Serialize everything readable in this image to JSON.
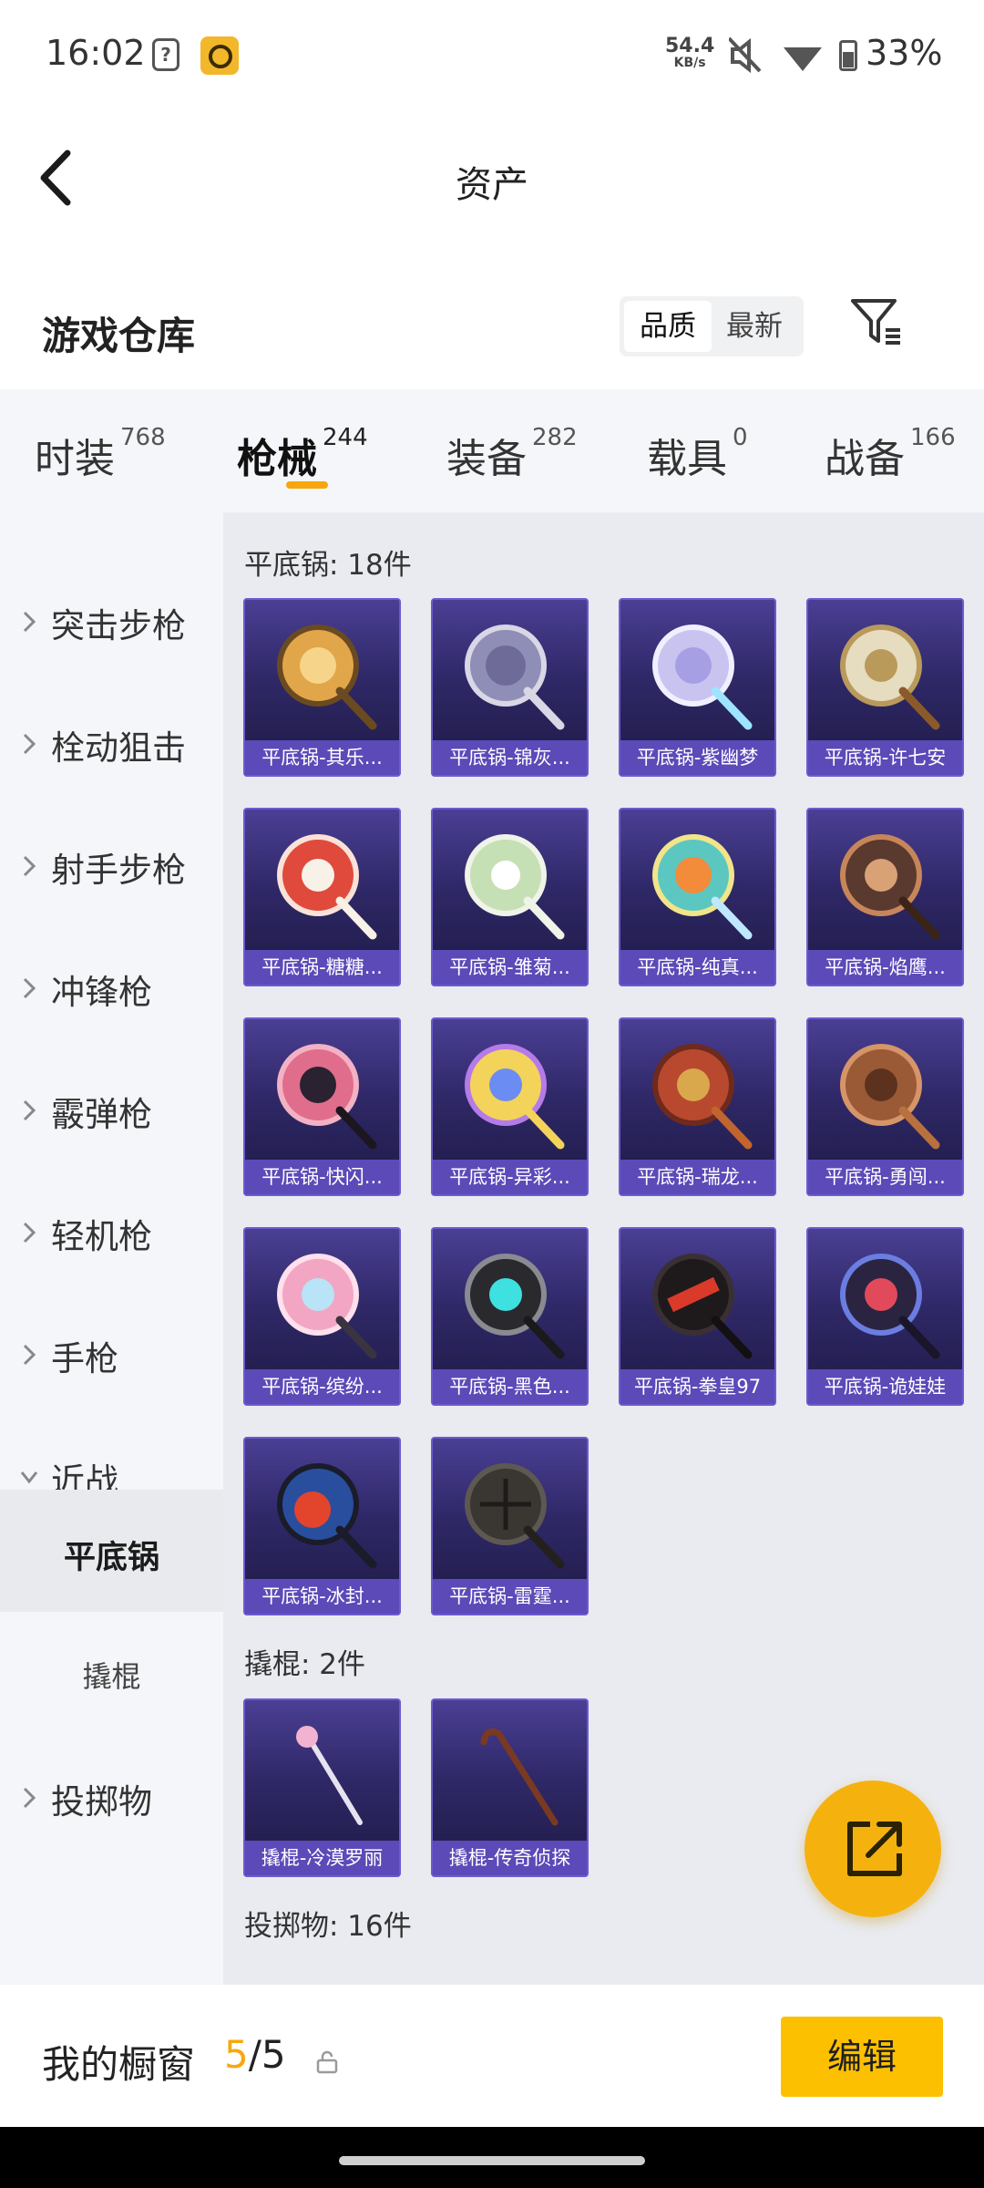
{
  "status_bar": {
    "time": "16:02",
    "notification_icon_glyph": "?",
    "net_speed_value": "54.4",
    "net_speed_unit": "KB/s",
    "battery": "33%",
    "icons": [
      "clock-time",
      "unknown-notification-icon",
      "app-icon",
      "mute-icon",
      "wifi-icon",
      "battery-icon"
    ]
  },
  "header": {
    "title": "资产",
    "back_icon": "chevron-left-icon"
  },
  "warehouse": {
    "title": "游戏仓库",
    "sort_options": [
      "品质",
      "最新"
    ],
    "sort_active": "品质",
    "filter_icon": "filter-icon"
  },
  "tabs": [
    {
      "label": "时装",
      "count": "768"
    },
    {
      "label": "枪械",
      "count": "244",
      "active": true
    },
    {
      "label": "装备",
      "count": "282"
    },
    {
      "label": "载具",
      "count": "0"
    },
    {
      "label": "战备",
      "count": "166"
    }
  ],
  "sidebar": {
    "items": [
      {
        "label": "突击步枪"
      },
      {
        "label": "栓动狙击"
      },
      {
        "label": "射手步枪"
      },
      {
        "label": "冲锋枪"
      },
      {
        "label": "霰弹枪"
      },
      {
        "label": "轻机枪"
      },
      {
        "label": "手枪"
      },
      {
        "label": "近战",
        "expanded": true
      },
      {
        "label": "平底锅",
        "sub": true,
        "active": true
      },
      {
        "label": "撬棍",
        "sub": true
      },
      {
        "label": "投掷物"
      }
    ]
  },
  "sections": {
    "pans_title": "平底锅: 18件",
    "crowbars_title": "撬棍: 2件",
    "throwables_title": "投掷物: 16件"
  },
  "pans": [
    "平底锅-其乐...",
    "平底锅-锦灰...",
    "平底锅-紫幽梦",
    "平底锅-许七安",
    "平底锅-糖糖...",
    "平底锅-雏菊...",
    "平底锅-纯真...",
    "平底锅-焰鹰...",
    "平底锅-快闪...",
    "平底锅-异彩...",
    "平底锅-瑞龙...",
    "平底锅-勇闯...",
    "平底锅-缤纷...",
    "平底锅-黑色...",
    "平底锅-拳皇97",
    "平底锅-诡娃娃",
    "平底锅-冰封...",
    "平底锅-雷霆..."
  ],
  "crowbars": [
    "撬棍-冷漠罗丽",
    "撬棍-传奇侦探"
  ],
  "fab": {
    "icon": "external-link-icon"
  },
  "showcase": {
    "label": "我的橱窗",
    "current": "5",
    "total": "/5",
    "lock_icon": "lock-icon",
    "edit_label": "编辑"
  },
  "colors": {
    "accent": "#f7a60d",
    "edit_button": "#fdc000",
    "card_name_bg": "#5b4ab8",
    "card_top": "#4a3f94",
    "card_bottom": "#1e1a45"
  }
}
